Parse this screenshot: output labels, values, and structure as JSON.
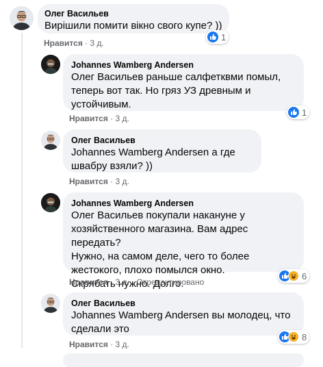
{
  "comments": [
    {
      "author": "Олег Васильев",
      "mention": "",
      "text": "Вирішили помити вікно свого купе? ))",
      "like_label": "Нравится",
      "time": "3 д.",
      "edited": "",
      "reaction_count": "1",
      "reactions": [
        "like-icon"
      ]
    },
    {
      "author": "Johannes Wamberg Andersen",
      "mention": "Олег Васильев",
      "text": " раньше салфетквми помыл, теперь вот так. Но гряз УЗ древным и устойчивым.",
      "like_label": "Нравится",
      "time": "3 д.",
      "edited": "",
      "reaction_count": "1",
      "reactions": [
        "like-icon"
      ]
    },
    {
      "author": "Олег Васильев",
      "mention": "Johannes Wamberg Andersen",
      "text": " а где швабру взяли? ))",
      "like_label": "Нравится",
      "time": "3 д.",
      "edited": "",
      "reaction_count": "",
      "reactions": []
    },
    {
      "author": "Johannes Wamberg Andersen",
      "mention": "Олег Васильев",
      "text_lines": [
        " покупали накануне у хозяйственного магазина. Вам адрес передать?",
        "Нужно, на самом деле, чего то более жестокого, плохо помылся окно.",
        "Скрябать нужно. Долго."
      ],
      "like_label": "Нравится",
      "time": "3 д.",
      "edited": "Отредактировано",
      "reaction_count": "6",
      "reactions": [
        "like-icon",
        "haha-icon"
      ]
    },
    {
      "author": "Олег Васильев",
      "mention": "Johannes Wamberg Andersen",
      "text": " вы молодец, что сделали это",
      "like_label": "Нравится",
      "time": "3 д.",
      "edited": "",
      "reaction_count": "8",
      "reactions": [
        "like-icon",
        "haha-icon"
      ]
    }
  ],
  "colors": {
    "bubble": "#f0f2f5",
    "meta": "#65676b",
    "like_blue": "#1877f2",
    "haha_yellow": "#f7b125"
  }
}
